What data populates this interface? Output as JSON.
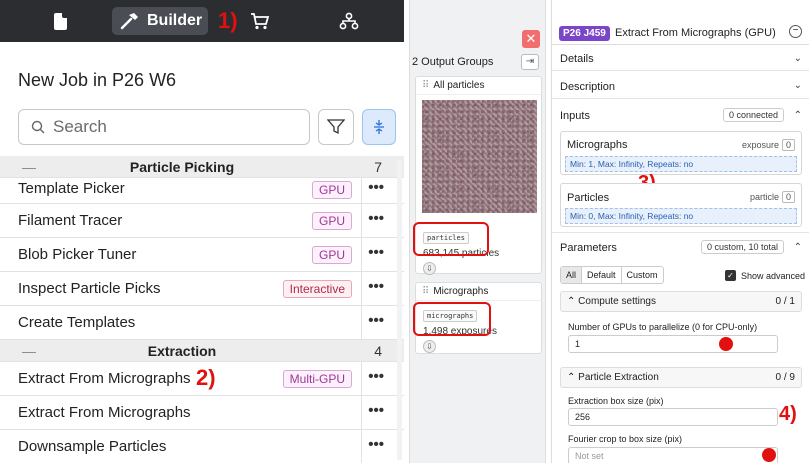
{
  "nav": {
    "builder_label": "Builder",
    "annotation": "1)"
  },
  "builder": {
    "job_title": "New Job in P26 W6",
    "search_placeholder": "Search",
    "categories": [
      {
        "name": "Particle Picking",
        "count": "7"
      },
      {
        "name": "Extraction",
        "count": "4"
      }
    ],
    "items": [
      {
        "name": "Template Picker",
        "badge": "GPU"
      },
      {
        "name": "Filament Tracer",
        "badge": "GPU"
      },
      {
        "name": "Blob Picker Tuner",
        "badge": "GPU"
      },
      {
        "name": "Inspect Particle Picks",
        "badge": "Interactive"
      },
      {
        "name": "Create Templates",
        "badge": ""
      },
      {
        "name": "Extract From Micrographs",
        "badge": "Multi-GPU"
      },
      {
        "name": "Extract From Micrographs",
        "badge": ""
      },
      {
        "name": "Downsample Particles",
        "badge": ""
      }
    ],
    "more_glyph": "•••",
    "annotation": "2)"
  },
  "outputs": {
    "title": "2 Output Groups",
    "groups": [
      {
        "name": "All particles",
        "tag": "particles",
        "count": "683,145 particles"
      },
      {
        "name": "Micrographs",
        "tag": "micrographs",
        "count": "1,498 exposures"
      }
    ]
  },
  "job": {
    "id": "P26 J459",
    "name": "Extract From Micrographs (GPU)",
    "sections": {
      "details": "Details",
      "description": "Description",
      "inputs": "Inputs",
      "inputs_pill": "0 connected",
      "parameters": "Parameters",
      "parameters_pill": "0 custom, 10 total"
    },
    "inputs": [
      {
        "name": "Micrographs",
        "type": "exposure",
        "count": "0",
        "rule": "Min: 1, Max: Infinity, Repeats: no"
      },
      {
        "name": "Particles",
        "type": "particle",
        "count": "0",
        "rule": "Min: 0, Max: Infinity, Repeats: no"
      }
    ],
    "annotation_inputs": "3)",
    "param_tabs": [
      "All",
      "Default",
      "Custom"
    ],
    "show_advanced": "Show advanced",
    "groups": [
      {
        "title": "Compute settings",
        "count": "0 / 1"
      },
      {
        "title": "Particle Extraction",
        "count": "0 / 9"
      }
    ],
    "params": [
      {
        "label": "Number of GPUs to parallelize (0 for CPU-only)",
        "value": "1"
      },
      {
        "label": "Extraction box size (pix)",
        "value": "256"
      },
      {
        "label": "Fourier crop to box size (pix)",
        "value": "Not set"
      }
    ],
    "annotation_params": "4)"
  },
  "colors": {
    "annotation_red": "#e0110e",
    "job_badge": "#7a46c7",
    "topbar": "#2b2d31"
  }
}
